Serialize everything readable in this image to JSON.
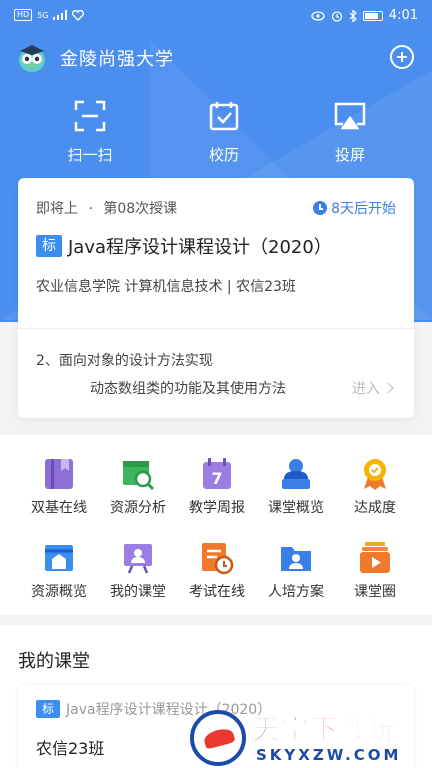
{
  "status_bar": {
    "network_badge": "HD",
    "network_type": "5G",
    "time": "4:01"
  },
  "header": {
    "title": "金陵尚强大学"
  },
  "quick_actions": [
    {
      "label": "扫一扫",
      "icon": "scan-icon"
    },
    {
      "label": "校历",
      "icon": "calendar-check-icon"
    },
    {
      "label": "投屏",
      "icon": "screen-cast-icon"
    }
  ],
  "upcoming": {
    "status": "即将上",
    "separator": "·",
    "session": "第08次授课",
    "countdown": "8天后开始",
    "tag": "标",
    "course_title": "Java程序设计课程设计（2020）",
    "course_info": "农业信息学院 计算机信息技术 | 农信23班",
    "topic": "2、面向对象的设计方法实现",
    "subtopic": "动态数组类的功能及其使用方法",
    "enter_label": "进入"
  },
  "features": [
    {
      "label": "双基在线",
      "icon": "book-bookmark-icon",
      "color": "#8e6fd8"
    },
    {
      "label": "资源分析",
      "icon": "resource-search-icon",
      "color": "#3cb55e"
    },
    {
      "label": "教学周报",
      "icon": "calendar-7-icon",
      "color": "#9b7de3"
    },
    {
      "label": "课堂概览",
      "icon": "teacher-podium-icon",
      "color": "#3a7ee8"
    },
    {
      "label": "达成度",
      "icon": "achievement-medal-icon",
      "color": "#f5b400"
    },
    {
      "label": "资源概览",
      "icon": "resource-overview-icon",
      "color": "#3a8ef0"
    },
    {
      "label": "我的课堂",
      "icon": "my-classroom-icon",
      "color": "#9b7de3"
    },
    {
      "label": "考试在线",
      "icon": "exam-clock-icon",
      "color": "#f07a2b"
    },
    {
      "label": "人培方案",
      "icon": "training-plan-icon",
      "color": "#3a7ee8"
    },
    {
      "label": "课堂圈",
      "icon": "class-circle-icon",
      "color": "#f07a2b"
    }
  ],
  "my_class": {
    "section_title": "我的课堂",
    "tag": "标",
    "course": "Java程序设计课程设计（2020）",
    "class_name": "农信23班"
  },
  "watermark": {
    "cn_blue": "天空",
    "cn_red": "下载玩",
    "en": "SKYXZW.COM"
  },
  "colors": {
    "primary": "#4a8ef0",
    "accent": "#3a7ee8",
    "background": "#f2f3f5"
  }
}
